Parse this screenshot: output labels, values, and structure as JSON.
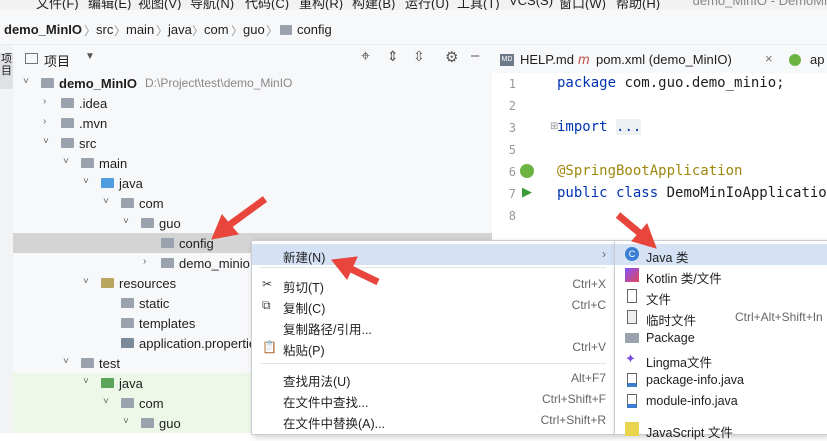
{
  "menubar": {
    "items": [
      "文件(F)",
      "编辑(E)",
      "视图(V)",
      "导航(N)",
      "代码(C)",
      "重构(R)",
      "构建(B)",
      "运行(U)",
      "工具(T)",
      "VCS(S)",
      "窗口(W)",
      "帮助(H)"
    ],
    "window_title": "demo_MinIO - DemoMi"
  },
  "breadcrumb": [
    "demo_MinIO",
    "src",
    "main",
    "java",
    "com",
    "guo",
    "config"
  ],
  "stripe_label": "项目",
  "project_panel": {
    "title": "项目",
    "rows": [
      {
        "label": "demo_MinIO",
        "path": "D:\\Project\\test\\demo_MinIO",
        "arrow": "˅",
        "icon": "folder",
        "bold": true
      },
      {
        "label": ".idea",
        "arrow": "›",
        "icon": "folder"
      },
      {
        "label": ".mvn",
        "arrow": "›",
        "icon": "folder"
      },
      {
        "label": "src",
        "arrow": "˅",
        "icon": "folder"
      },
      {
        "label": "main",
        "arrow": "˅",
        "icon": "folder"
      },
      {
        "label": "java",
        "arrow": "˅",
        "icon": "folder-blue"
      },
      {
        "label": "com",
        "arrow": "˅",
        "icon": "package"
      },
      {
        "label": "guo",
        "arrow": "˅",
        "icon": "package"
      },
      {
        "label": "config",
        "arrow": "",
        "icon": "package",
        "selected": true
      },
      {
        "label": "demo_minio",
        "arrow": "›",
        "icon": "package"
      },
      {
        "label": "resources",
        "arrow": "˅",
        "icon": "folder-res"
      },
      {
        "label": "static",
        "arrow": "",
        "icon": "folder"
      },
      {
        "label": "templates",
        "arrow": "",
        "icon": "folder"
      },
      {
        "label": "application.properties",
        "arrow": "",
        "icon": "properties"
      },
      {
        "label": "test",
        "arrow": "˅",
        "icon": "folder"
      },
      {
        "label": "java",
        "arrow": "˅",
        "icon": "folder-green",
        "test": true
      },
      {
        "label": "com",
        "arrow": "˅",
        "icon": "package",
        "test": true
      },
      {
        "label": "guo",
        "arrow": "˅",
        "icon": "package",
        "test": true
      }
    ]
  },
  "editor": {
    "tabs": [
      "HELP.md",
      "pom.xml (demo_MinIO)",
      "ap"
    ],
    "lines": [
      {
        "n": "1",
        "text": "package com.guo.demo_minio;"
      },
      {
        "n": "2",
        "text": ""
      },
      {
        "n": "3",
        "text": "import ..."
      },
      {
        "n": "5",
        "text": ""
      },
      {
        "n": "6",
        "text": "@SpringBootApplication"
      },
      {
        "n": "7",
        "text": "public class DemoMinIoApplication"
      },
      {
        "n": "8",
        "text": ""
      }
    ]
  },
  "context_menu": {
    "items": [
      {
        "label": "新建(N)",
        "shortcut": "",
        "submenu": true,
        "selected": true
      },
      {
        "label": "剪切(T)",
        "shortcut": "Ctrl+X",
        "icon": "scissors-icon"
      },
      {
        "label": "复制(C)",
        "shortcut": "Ctrl+C",
        "icon": "copy-icon"
      },
      {
        "label": "复制路径/引用...",
        "shortcut": ""
      },
      {
        "label": "粘贴(P)",
        "shortcut": "Ctrl+V",
        "icon": "paste-icon"
      },
      {
        "label": "查找用法(U)",
        "shortcut": "Alt+F7"
      },
      {
        "label": "在文件中查找...",
        "shortcut": "Ctrl+Shift+F"
      },
      {
        "label": "在文件中替换(A)...",
        "shortcut": "Ctrl+Shift+R"
      }
    ]
  },
  "submenu": {
    "items": [
      {
        "label": "Java 类",
        "icon": "java-class-icon",
        "selected": true
      },
      {
        "label": "Kotlin 类/文件",
        "icon": "kotlin-icon"
      },
      {
        "label": "文件",
        "icon": "file-icon"
      },
      {
        "label": "临时文件",
        "shortcut": "Ctrl+Alt+Shift+In",
        "icon": "scratch-file-icon"
      },
      {
        "label": "Package",
        "icon": "package-icon"
      },
      {
        "label": "Lingma文件",
        "icon": "lingma-icon"
      },
      {
        "label": "package-info.java",
        "icon": "java-file-icon"
      },
      {
        "label": "module-info.java",
        "icon": "java-file-icon"
      },
      {
        "label": "JavaScript 文件",
        "icon": "js-file-icon"
      }
    ]
  },
  "colors": {
    "accent_arrow": "#e8453c",
    "selection": "#d5e1f5",
    "tree_selection": "#d4d4d4",
    "test_bg": "#eef8e8"
  }
}
